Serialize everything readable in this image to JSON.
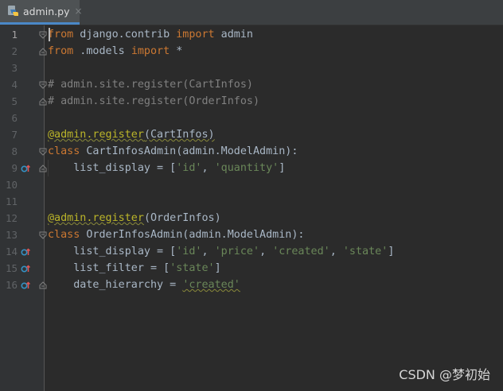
{
  "tab": {
    "filename": "admin.py",
    "close": "×"
  },
  "lines": [
    {
      "n": "1",
      "parts": [
        [
          "kw",
          "from"
        ],
        [
          "p",
          " django.contrib "
        ],
        [
          "kw",
          "import"
        ],
        [
          "p",
          " admin"
        ]
      ],
      "fold": "open",
      "active": true
    },
    {
      "n": "2",
      "parts": [
        [
          "kw",
          "from"
        ],
        [
          "p",
          " .models "
        ],
        [
          "kw",
          "import"
        ],
        [
          "p",
          " *"
        ]
      ],
      "fold": "close"
    },
    {
      "n": "3",
      "parts": []
    },
    {
      "n": "4",
      "parts": [
        [
          "cmt",
          "# admin.site.register(CartInfos)"
        ]
      ],
      "fold": "open"
    },
    {
      "n": "5",
      "parts": [
        [
          "cmt",
          "# admin.site.register(OrderInfos)"
        ]
      ],
      "fold": "close"
    },
    {
      "n": "6",
      "parts": []
    },
    {
      "n": "7",
      "parts": [
        [
          "dec",
          "@admin.register"
        ],
        [
          "sq",
          "(CartInfos)"
        ]
      ]
    },
    {
      "n": "8",
      "parts": [
        [
          "kw",
          "class"
        ],
        [
          "p",
          " CartInfosAdmin(admin.ModelAdmin):"
        ]
      ],
      "fold": "open"
    },
    {
      "n": "9",
      "parts": [
        [
          "p",
          "    list_display = ["
        ],
        [
          "str",
          "'id'"
        ],
        [
          "p",
          ", "
        ],
        [
          "str",
          "'quantity'"
        ],
        [
          "p",
          "]"
        ]
      ],
      "fold": "close",
      "marker": true
    },
    {
      "n": "10",
      "parts": []
    },
    {
      "n": "11",
      "parts": []
    },
    {
      "n": "12",
      "parts": [
        [
          "dec",
          "@admin.register"
        ],
        [
          "p",
          "(OrderInfos)"
        ]
      ]
    },
    {
      "n": "13",
      "parts": [
        [
          "kw",
          "class"
        ],
        [
          "p",
          " OrderInfosAdmin(admin.ModelAdmin):"
        ]
      ],
      "fold": "open"
    },
    {
      "n": "14",
      "parts": [
        [
          "p",
          "    list_display = ["
        ],
        [
          "str",
          "'id'"
        ],
        [
          "p",
          ", "
        ],
        [
          "str",
          "'price'"
        ],
        [
          "p",
          ", "
        ],
        [
          "str",
          "'created'"
        ],
        [
          "p",
          ", "
        ],
        [
          "str",
          "'state'"
        ],
        [
          "p",
          "]"
        ]
      ],
      "marker": true
    },
    {
      "n": "15",
      "parts": [
        [
          "p",
          "    list_filter = ["
        ],
        [
          "str",
          "'state'"
        ],
        [
          "p",
          "]"
        ]
      ],
      "marker": true
    },
    {
      "n": "16",
      "parts": [
        [
          "p",
          "    date_hierarchy = "
        ],
        [
          "strsq",
          "'created'"
        ]
      ],
      "fold": "close",
      "marker": true
    }
  ],
  "watermark": "CSDN @梦初始",
  "icons": {
    "tab": "python-file-icon",
    "marker": "override-method-icon",
    "fold": "fold-toggle-icon"
  },
  "colors": {
    "keyword": "#cc7832",
    "string": "#6a8759",
    "comment": "#808080",
    "decorator": "#bbb529",
    "text": "#a9b7c6"
  }
}
